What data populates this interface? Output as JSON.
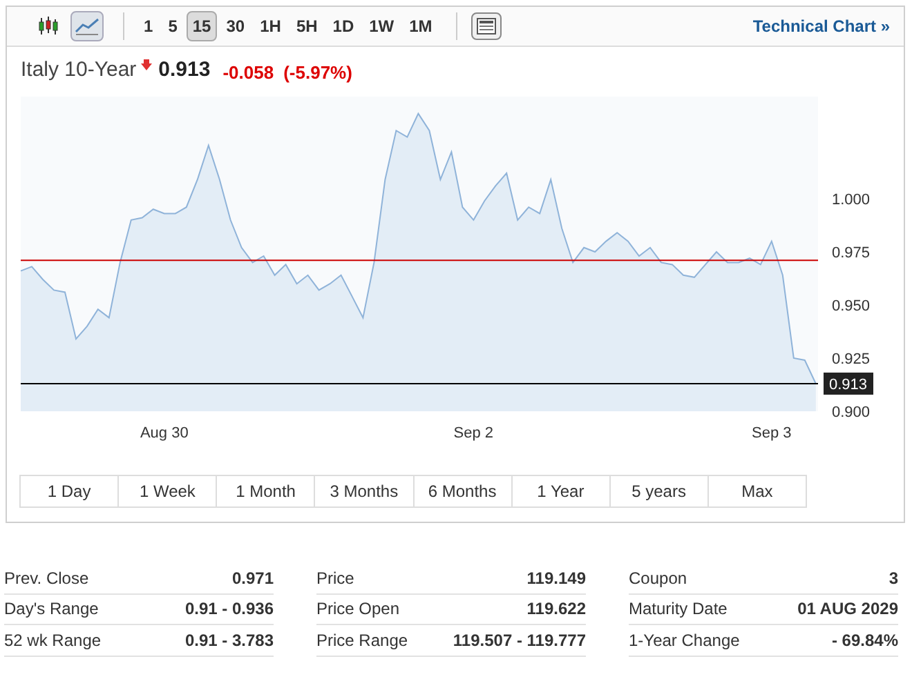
{
  "toolbar": {
    "chart_types": [
      {
        "kind": "candlestick",
        "selected": false
      },
      {
        "kind": "line",
        "selected": true
      }
    ],
    "intervals": [
      {
        "label": "1",
        "selected": false
      },
      {
        "label": "5",
        "selected": false
      },
      {
        "label": "15",
        "selected": true
      },
      {
        "label": "30",
        "selected": false
      },
      {
        "label": "1H",
        "selected": false
      },
      {
        "label": "5H",
        "selected": false
      },
      {
        "label": "1D",
        "selected": false
      },
      {
        "label": "1W",
        "selected": false
      },
      {
        "label": "1M",
        "selected": false
      }
    ],
    "technical_link": "Technical Chart »"
  },
  "quote": {
    "name": "Italy 10-Year",
    "falling": true,
    "price": "0.913",
    "change": "-0.058",
    "change_percent": "(-5.97%)"
  },
  "chart_data": {
    "type": "area",
    "categories": [
      null,
      null,
      null,
      null,
      null,
      null,
      null,
      null,
      null,
      null,
      null,
      null,
      null,
      "Aug 30",
      null,
      null,
      null,
      null,
      null,
      null,
      null,
      null,
      null,
      null,
      null,
      null,
      null,
      null,
      null,
      null,
      null,
      null,
      null,
      null,
      null,
      null,
      null,
      null,
      null,
      null,
      null,
      "Sep 2",
      null,
      null,
      null,
      null,
      null,
      null,
      null,
      null,
      null,
      null,
      null,
      null,
      null,
      null,
      null,
      null,
      null,
      null,
      null,
      null,
      null,
      null,
      null,
      null,
      null,
      null,
      "Sep 3",
      null,
      null,
      null,
      null
    ],
    "series": [
      {
        "color": "#8fb3d9",
        "values": [
          0.966,
          0.968,
          0.962,
          0.957,
          0.956,
          0.934,
          0.94,
          0.948,
          0.944,
          0.97,
          0.99,
          0.991,
          0.995,
          0.993,
          0.993,
          0.996,
          1.009,
          1.025,
          1.009,
          0.99,
          0.977,
          0.97,
          0.973,
          0.964,
          0.969,
          0.96,
          0.964,
          0.957,
          0.96,
          0.964,
          0.954,
          0.944,
          0.97,
          1.009,
          1.032,
          1.029,
          1.04,
          1.032,
          1.009,
          1.022,
          0.996,
          0.99,
          0.999,
          1.006,
          1.012,
          0.99,
          0.996,
          0.993,
          1.009,
          0.986,
          0.97,
          0.977,
          0.975,
          0.98,
          0.984,
          0.98,
          0.973,
          0.977,
          0.97,
          0.969,
          0.964,
          0.963,
          0.969,
          0.975,
          0.97,
          0.97,
          0.972,
          0.969,
          0.98,
          0.964,
          0.925,
          0.924,
          0.913
        ]
      }
    ],
    "ylim": [
      0.9,
      1.048
    ],
    "yticks": [
      {
        "value": 0.9,
        "label": "0.900"
      },
      {
        "value": 0.925,
        "label": "0.925"
      },
      {
        "value": 0.95,
        "label": "0.950"
      },
      {
        "value": 0.975,
        "label": "0.975"
      },
      {
        "value": 1.0,
        "label": "1.000"
      }
    ],
    "ref_lines": [
      {
        "axis": "y",
        "value": 0.971,
        "color": "#cc0000"
      },
      {
        "axis": "y",
        "value": 0.913,
        "color": "#000000",
        "label": "0.913"
      }
    ]
  },
  "ranges": [
    {
      "label": "1 Day",
      "selected": false
    },
    {
      "label": "1 Week",
      "selected": false
    },
    {
      "label": "1 Month",
      "selected": false
    },
    {
      "label": "3 Months",
      "selected": false
    },
    {
      "label": "6 Months",
      "selected": false
    },
    {
      "label": "1 Year",
      "selected": false
    },
    {
      "label": "5 years",
      "selected": false
    },
    {
      "label": "Max",
      "selected": false
    }
  ],
  "stats": [
    [
      {
        "label": "Prev. Close",
        "value": "0.971"
      },
      {
        "label": "Day's Range",
        "value": "0.91 - 0.936"
      },
      {
        "label": "52 wk Range",
        "value": "0.91 - 3.783"
      }
    ],
    [
      {
        "label": "Price",
        "value": "119.149"
      },
      {
        "label": "Price Open",
        "value": "119.622"
      },
      {
        "label": "Price Range",
        "value": "119.507 - 119.777"
      }
    ],
    [
      {
        "label": "Coupon",
        "value": "3"
      },
      {
        "label": "Maturity Date",
        "value": "01 AUG 2029"
      },
      {
        "label": "1-Year Change",
        "value": "- 69.84%"
      }
    ]
  ]
}
